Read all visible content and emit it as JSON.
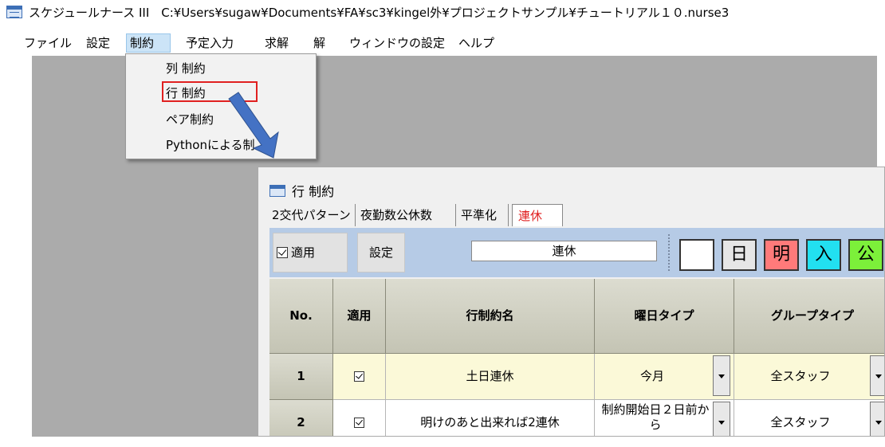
{
  "window": {
    "title": "スケジュールナース III　C:¥Users¥sugaw¥Documents¥FA¥sc3¥kingel外¥プロジェクトサンプル¥チュートリアル１０.nurse3"
  },
  "menubar": {
    "items": [
      "ファイル",
      "設定",
      "制約",
      "予定入力",
      "求解",
      "解",
      "ウィンドウの設定",
      "ヘルプ"
    ],
    "active": "制約"
  },
  "dropdown": {
    "items": [
      "列 制約",
      "行 制約",
      "ペア制約",
      "Pythonによる制"
    ],
    "highlighted": "行 制約"
  },
  "subwindow": {
    "title": "行 制約",
    "tabs": [
      "2交代パターン",
      "夜勤数公休数",
      "平準化",
      "連休"
    ],
    "active_tab": "連休",
    "toolbar": {
      "apply_label": "適用",
      "settings_label": "設定",
      "name_value": "連休",
      "palette": [
        {
          "label": "",
          "color": "#ffffff"
        },
        {
          "label": "日",
          "color": "#e6e6e6"
        },
        {
          "label": "明",
          "color": "#ff7a7a"
        },
        {
          "label": "入",
          "color": "#22e0f0"
        },
        {
          "label": "公",
          "color": "#7cf03a"
        }
      ]
    },
    "grid": {
      "headers": [
        "No.",
        "適用",
        "行制約名",
        "曜日タイプ",
        "グループタイプ"
      ],
      "rows": [
        {
          "no": "1",
          "apply": true,
          "name": "土日連休",
          "weekday_type": "今月",
          "group_type": "全スタッフ"
        },
        {
          "no": "2",
          "apply": true,
          "name": "明けのあと出来れば2連休",
          "weekday_type": "制約開始日２日前から",
          "group_type": "全スタッフ"
        }
      ]
    }
  },
  "colors": {
    "highlight_box": "#e02020",
    "arrow": "#4472c4",
    "workspace": "#ababab",
    "toolbar": "#b6cbe6"
  }
}
